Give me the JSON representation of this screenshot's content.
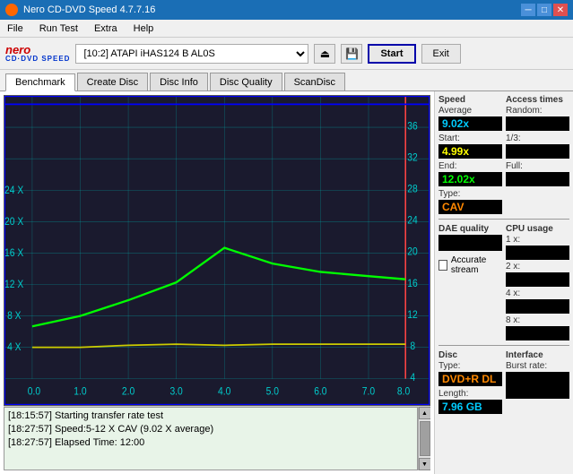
{
  "titleBar": {
    "title": "Nero CD-DVD Speed 4.7.7.16",
    "controls": [
      "minimize",
      "maximize",
      "close"
    ]
  },
  "menuBar": {
    "items": [
      "File",
      "Run Test",
      "Extra",
      "Help"
    ]
  },
  "toolbar": {
    "logo": {
      "nero": "nero",
      "cdspeed": "CD·DVD SPEED"
    },
    "drive": "[10:2]  ATAPI iHAS124  B AL0S",
    "startLabel": "Start",
    "exitLabel": "Exit"
  },
  "tabs": [
    {
      "label": "Benchmark",
      "active": true
    },
    {
      "label": "Create Disc",
      "active": false
    },
    {
      "label": "Disc Info",
      "active": false
    },
    {
      "label": "Disc Quality",
      "active": false
    },
    {
      "label": "ScanDisc",
      "active": false
    }
  ],
  "chart": {
    "xLabels": [
      "0.0",
      "1.0",
      "2.0",
      "3.0",
      "4.0",
      "5.0",
      "6.0",
      "7.0",
      "8.0"
    ],
    "yLeft": [
      "4 X",
      "8 X",
      "12 X",
      "16 X",
      "20 X",
      "24 X"
    ],
    "yRight": [
      "4",
      "8",
      "12",
      "16",
      "20",
      "24",
      "28",
      "32",
      "36"
    ]
  },
  "log": {
    "lines": [
      "[18:15:57]  Starting transfer rate test",
      "[18:27:57]  Speed:5-12 X CAV (9.02 X average)",
      "[18:27:57]  Elapsed Time: 12:00"
    ]
  },
  "rightPanel": {
    "speed": {
      "label": "Speed",
      "average": {
        "label": "Average",
        "value": "9.02x"
      },
      "start": {
        "label": "Start:",
        "value": "4.99x"
      },
      "end": {
        "label": "End:",
        "value": "12.02x"
      },
      "type": {
        "label": "Type:",
        "value": "CAV"
      }
    },
    "accessTimes": {
      "label": "Access times",
      "random": {
        "label": "Random:",
        "value": ""
      },
      "oneThird": {
        "label": "1/3:",
        "value": ""
      },
      "full": {
        "label": "Full:",
        "value": ""
      }
    },
    "daeQuality": {
      "label": "DAE quality",
      "value": ""
    },
    "accurateStream": {
      "label": "Accurate stream",
      "checked": false
    },
    "cpuUsage": {
      "label": "CPU usage",
      "1x": {
        "label": "1 x:",
        "value": ""
      },
      "2x": {
        "label": "2 x:",
        "value": ""
      },
      "4x": {
        "label": "4 x:",
        "value": ""
      },
      "8x": {
        "label": "8 x:",
        "value": ""
      }
    },
    "disc": {
      "label": "Disc",
      "type": {
        "label": "Type:",
        "value": "DVD+R DL"
      },
      "length": {
        "label": "Length:",
        "value": "7.96 GB"
      }
    },
    "interface": {
      "label": "Interface",
      "burstRate": {
        "label": "Burst rate:",
        "value": ""
      }
    }
  }
}
